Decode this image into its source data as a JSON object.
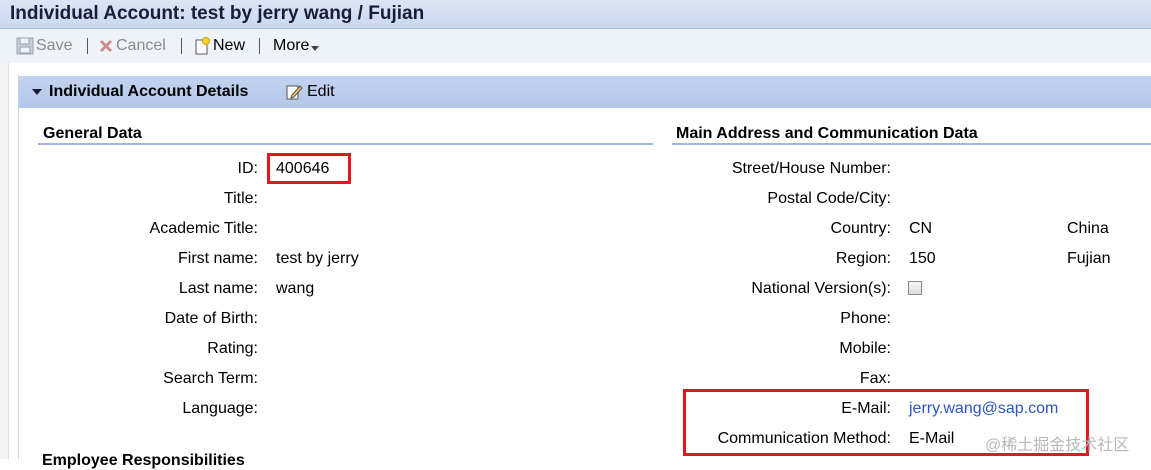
{
  "window": {
    "title": "Individual Account: test by jerry wang / Fujian"
  },
  "toolbar": {
    "save_label": "Save",
    "cancel_label": "Cancel",
    "new_label": "New",
    "more_label": "More"
  },
  "panel": {
    "title": "Individual Account Details",
    "edit_label": "Edit"
  },
  "general": {
    "heading": "General Data",
    "fields": [
      {
        "label": "ID:",
        "value": "400646"
      },
      {
        "label": "Title:",
        "value": ""
      },
      {
        "label": "Academic Title:",
        "value": ""
      },
      {
        "label": "First name:",
        "value": "test by jerry"
      },
      {
        "label": "Last name:",
        "value": "wang"
      },
      {
        "label": "Date of Birth:",
        "value": ""
      },
      {
        "label": "Rating:",
        "value": ""
      },
      {
        "label": "Search Term:",
        "value": ""
      },
      {
        "label": "Language:",
        "value": ""
      }
    ]
  },
  "address": {
    "heading": "Main Address and Communication Data",
    "fields": [
      {
        "label": "Street/House Number:",
        "value": "",
        "value2": ""
      },
      {
        "label": "Postal Code/City:",
        "value": "",
        "value2": ""
      },
      {
        "label": "Country:",
        "value": "CN",
        "value2": "China"
      },
      {
        "label": "Region:",
        "value": "150",
        "value2": "Fujian"
      },
      {
        "label": "National Version(s):",
        "value": "",
        "value2": ""
      },
      {
        "label": "Phone:",
        "value": "",
        "value2": ""
      },
      {
        "label": "Mobile:",
        "value": "",
        "value2": ""
      },
      {
        "label": "Fax:",
        "value": "",
        "value2": ""
      },
      {
        "label": "E-Mail:",
        "value": "jerry.wang@sap.com",
        "value2": ""
      },
      {
        "label": "Communication Method:",
        "value": "E-Mail",
        "value2": ""
      }
    ]
  },
  "next_section": {
    "heading": "Employee Responsibilities"
  },
  "watermark": "@稀土掘金技术社区",
  "colors": {
    "highlight": "#e8151f",
    "link": "#2a55c4",
    "header_bg": "#b3c7ea"
  }
}
